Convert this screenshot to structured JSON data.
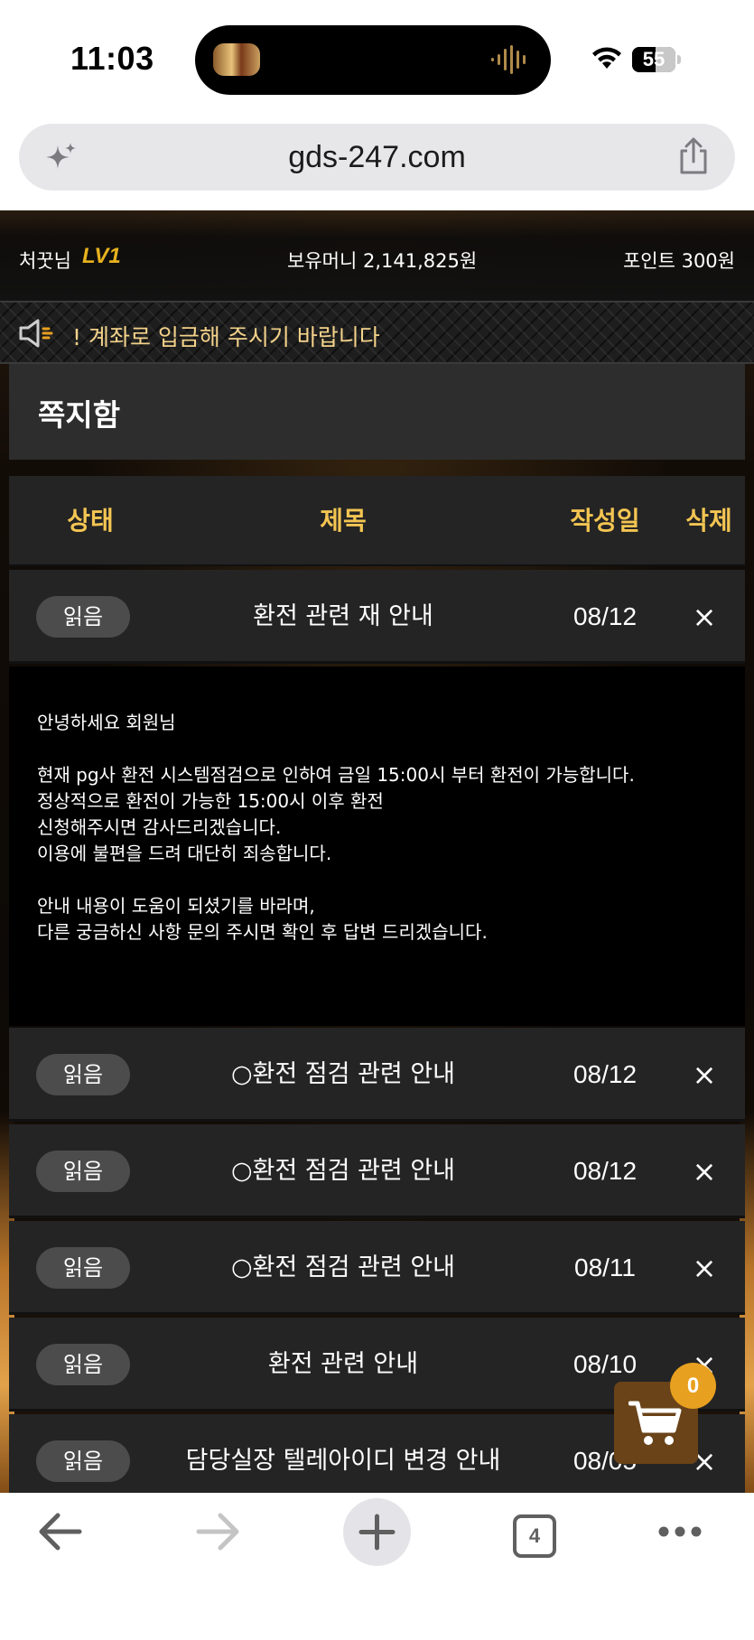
{
  "status_bar": {
    "time": "11:03",
    "battery_label": "55",
    "battery_fraction": 0.55
  },
  "browser": {
    "url": "gds-247.com",
    "tab_count": "4"
  },
  "user": {
    "nickname": "처꿋님",
    "level": "LV1",
    "money": "보유머니 2,141,825원",
    "points": "포인트 300원"
  },
  "notice": {
    "text": "! 계좌로 입금해 주시기 바랍니다"
  },
  "page": {
    "title": "쪽지함"
  },
  "table": {
    "headers": {
      "status": "상태",
      "title": "제목",
      "date": "작성일",
      "delete": "삭제"
    },
    "rows": [
      {
        "status": "읽음",
        "title": "환전 관련 재 안내",
        "date": "08/12",
        "delete": "×"
      },
      {
        "status": "읽음",
        "title": "○환전 점검 관련 안내",
        "date": "08/12",
        "delete": "×"
      },
      {
        "status": "읽음",
        "title": "○환전 점검 관련 안내",
        "date": "08/12",
        "delete": "×"
      },
      {
        "status": "읽음",
        "title": "○환전 점검 관련 안내",
        "date": "08/11",
        "delete": "×"
      },
      {
        "status": "읽음",
        "title": "환전 관련 안내",
        "date": "08/10",
        "delete": "×"
      },
      {
        "status": "읽음",
        "title": "담당실장 텔레아이디 변경 안내",
        "date": "08/05",
        "delete": "×"
      }
    ]
  },
  "message": {
    "lines": [
      "안녕하세요 회원님",
      "현재 pg사 환전 시스템점검으로 인하여 금일 15:00시 부터 환전이 가능합니다.",
      "정상적으로 환전이 가능한 15:00시 이후 환전",
      "신청해주시면 감사드리겠습니다.",
      "이용에 불편을 드려 대단히 죄송합니다.",
      "안내 내용이 도움이 되셨기를 바라며,",
      "다른 궁금하신 사항 문의 주시면 확인 후 답변 드리겠습니다."
    ]
  },
  "cart": {
    "count": "0"
  },
  "colors": {
    "accent_gold": "#f3c552",
    "level_gold": "#e8b21e",
    "cart_badge": "#e8a020",
    "row_bg": "#242424",
    "badge_bg": "#4c4c4c"
  },
  "icons": [
    "sparkle-icon",
    "share-icon",
    "speaker-icon",
    "close-icon",
    "cart-icon",
    "back-arrow-icon",
    "forward-arrow-icon",
    "plus-icon",
    "tabs-icon",
    "more-icon",
    "wifi-icon",
    "battery-icon"
  ]
}
